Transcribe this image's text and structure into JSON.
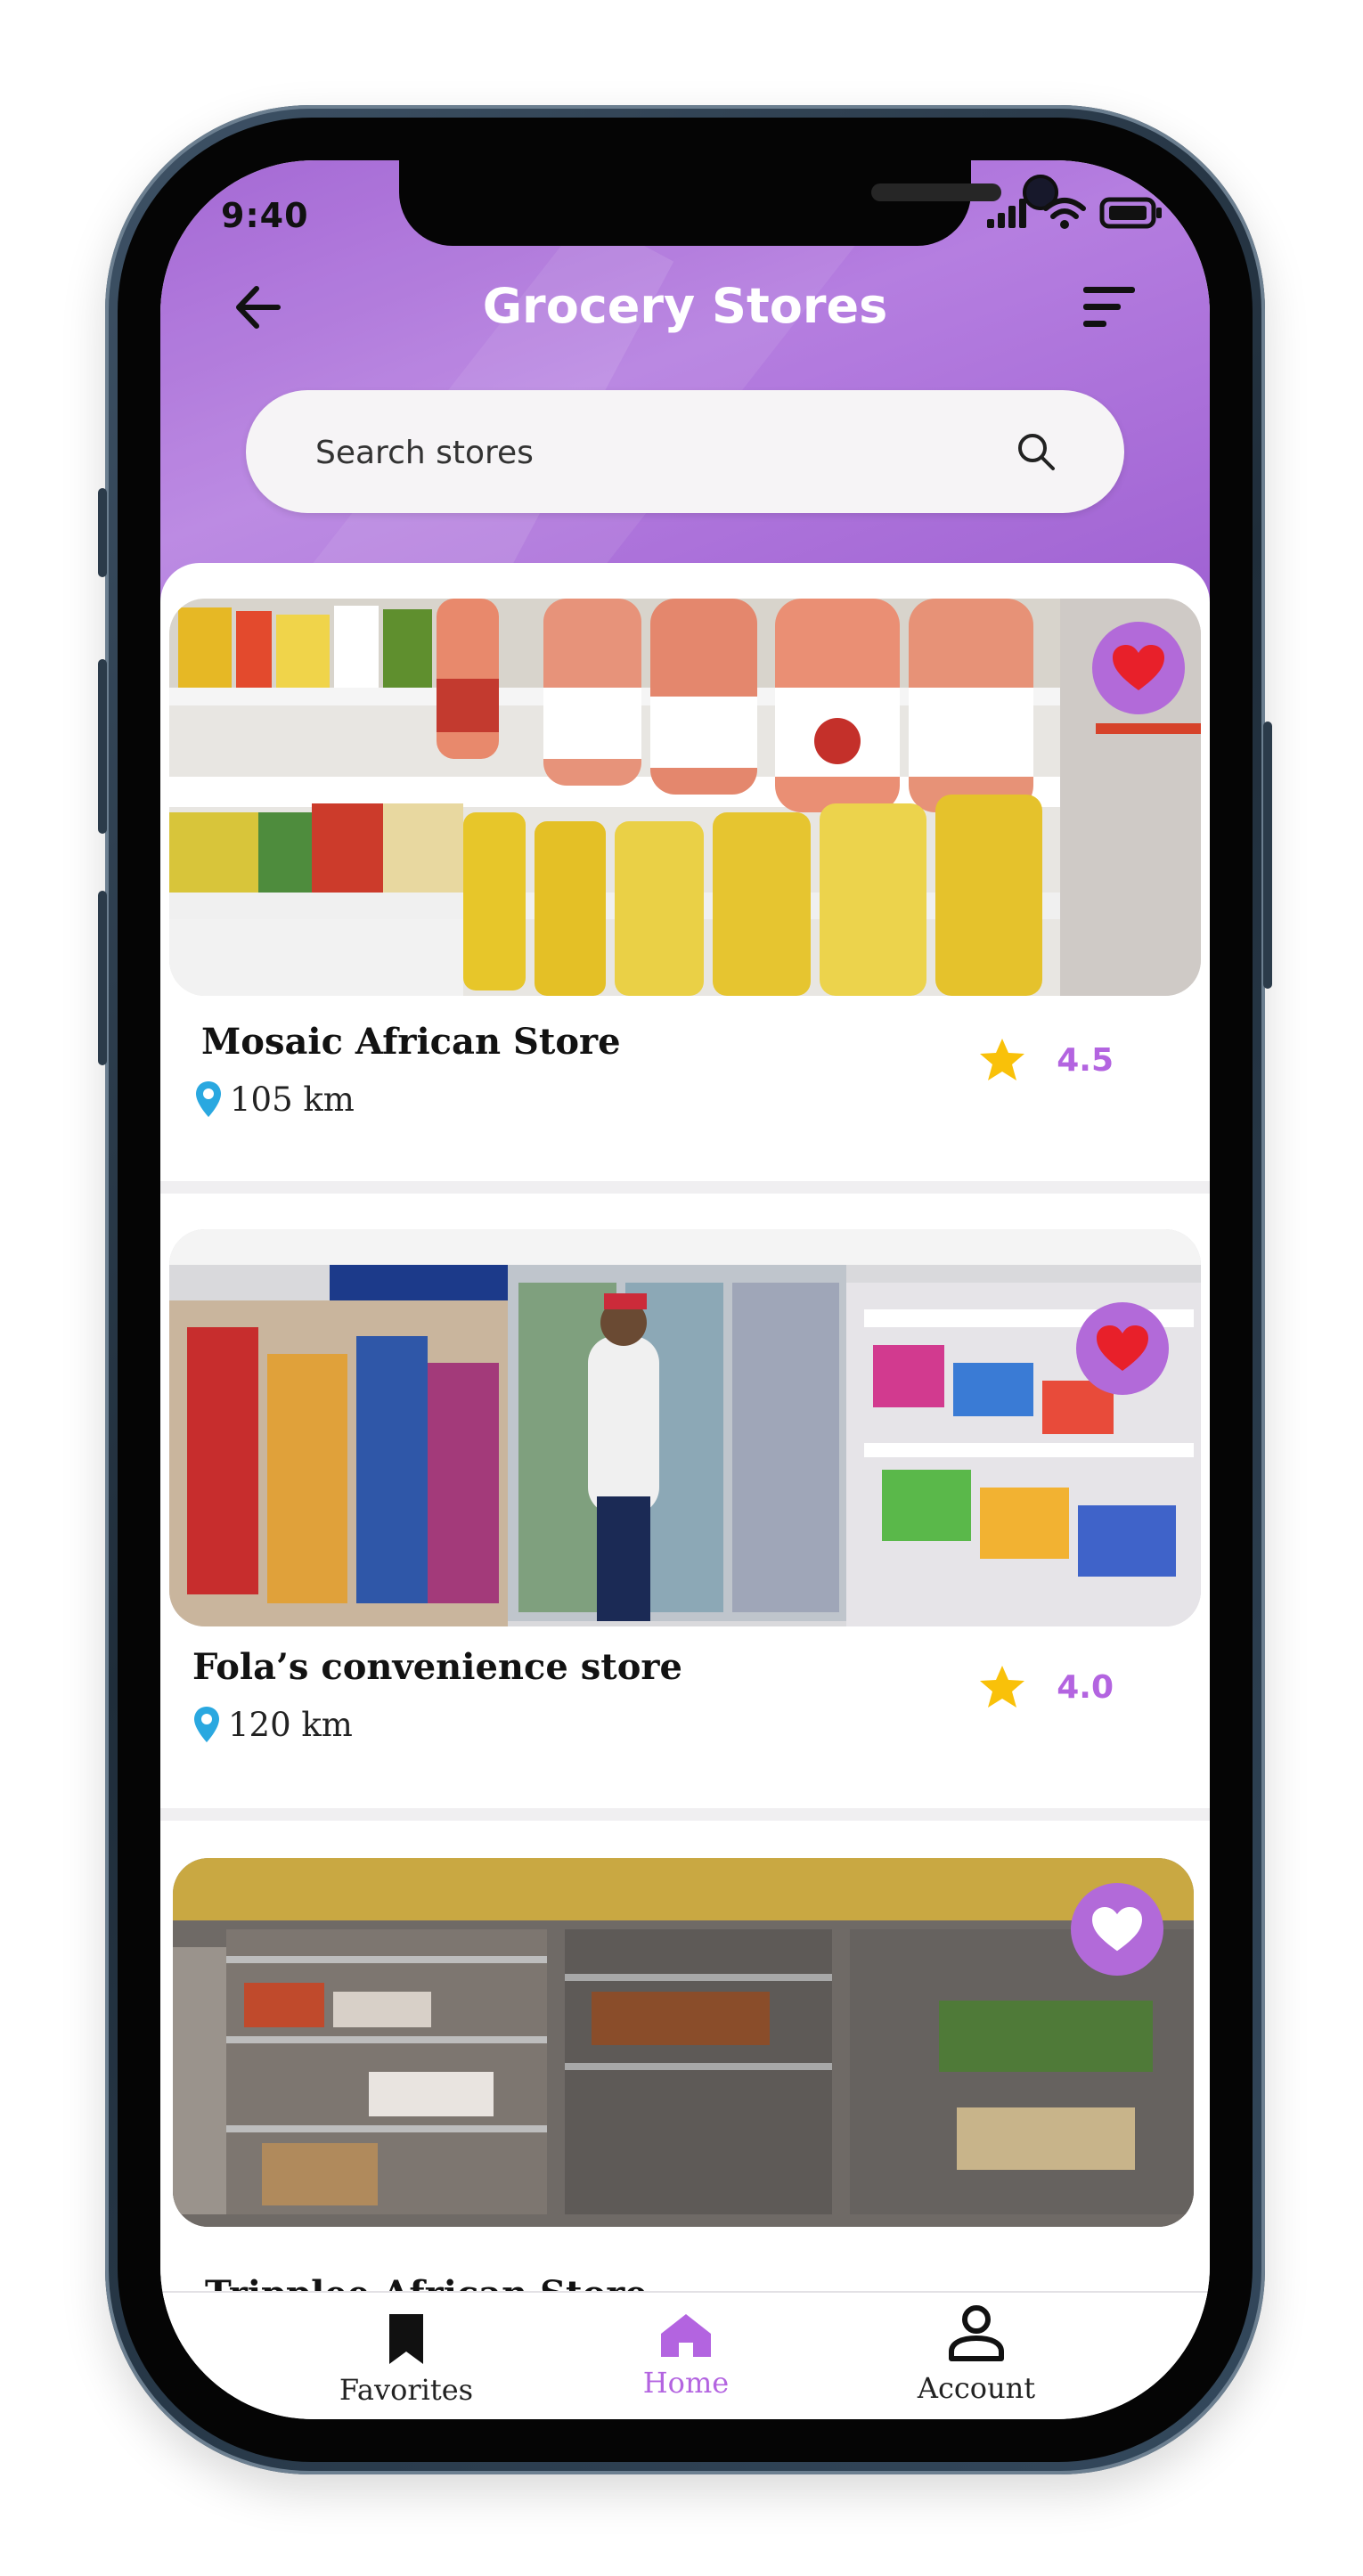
{
  "status_bar": {
    "time": "9:40"
  },
  "header": {
    "title": "Grocery Stores",
    "back_icon": "arrow-left-icon",
    "filter_icon": "sort-lines-icon"
  },
  "search": {
    "placeholder": "Search stores",
    "value": ""
  },
  "stores": [
    {
      "name": "Mosaic African Store",
      "distance": "105 km",
      "rating": "4.5",
      "favorited": true
    },
    {
      "name": "Fola’s convenience store",
      "distance": "120 km",
      "rating": "4.0",
      "favorited": true
    },
    {
      "name": "Tripplee African Store",
      "distance": "",
      "rating": "",
      "favorited": false
    }
  ],
  "bottom_nav": {
    "items": [
      {
        "label": "Favorites",
        "icon": "bookmark-icon",
        "active": false
      },
      {
        "label": "Home",
        "icon": "home-icon",
        "active": true
      },
      {
        "label": "Account",
        "icon": "person-icon",
        "active": false
      }
    ]
  },
  "colors": {
    "accent": "#b364e0",
    "header_purple": "#a465d6",
    "favorite_heart": "#e8202a",
    "star": "#f9c109",
    "location_pin": "#2aa8e0"
  }
}
